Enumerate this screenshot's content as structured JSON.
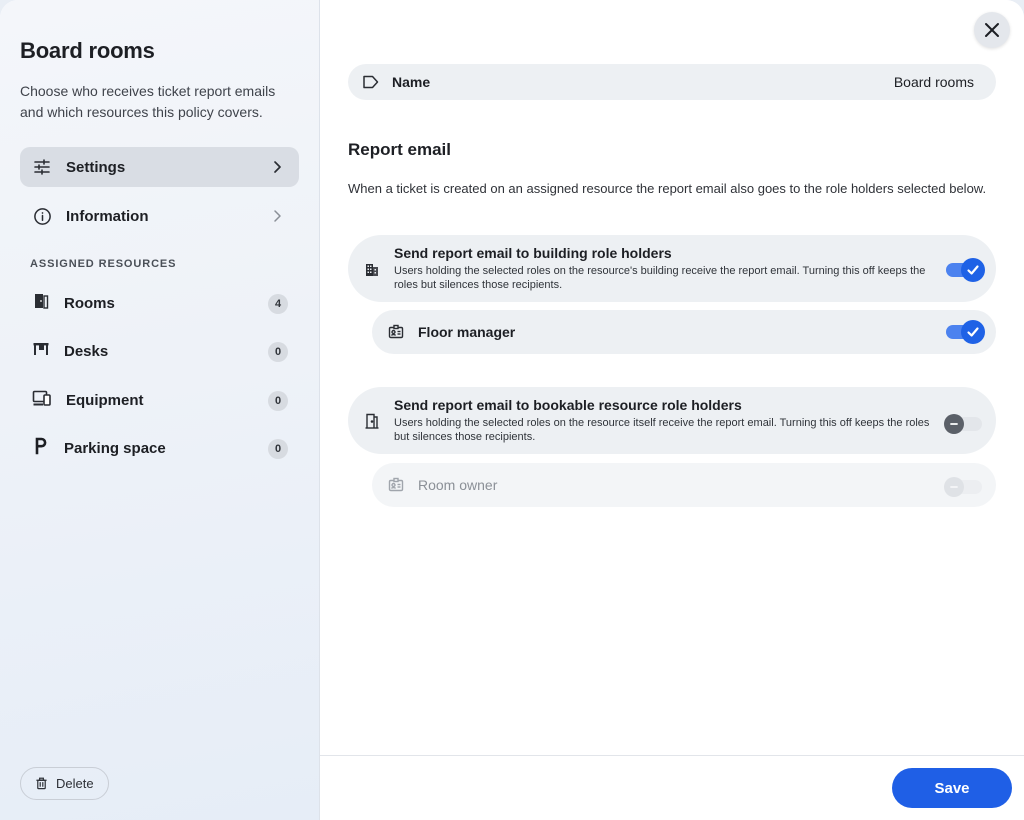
{
  "sidebar": {
    "title": "Board rooms",
    "description": "Choose who receives ticket report emails and which resources this policy covers.",
    "nav": [
      {
        "label": "Settings",
        "icon": "sliders-icon"
      },
      {
        "label": "Information",
        "icon": "info-icon"
      }
    ],
    "section_label": "ASSIGNED RESOURCES",
    "resources": [
      {
        "label": "Rooms",
        "count": "4",
        "icon": "door-icon"
      },
      {
        "label": "Desks",
        "count": "0",
        "icon": "desk-icon"
      },
      {
        "label": "Equipment",
        "count": "0",
        "icon": "devices-icon"
      },
      {
        "label": "Parking space",
        "count": "0",
        "icon": "parking-icon"
      }
    ],
    "delete_label": "Delete"
  },
  "main": {
    "name_field": {
      "label": "Name",
      "value": "Board rooms"
    },
    "section_title": "Report email",
    "section_desc": "When a ticket is created on an assigned resource the report email also goes to the role holders selected below.",
    "cards": [
      {
        "title": "Send report email to building role holders",
        "description": "Users holding the selected roles on the resource's building receive the report email. Turning this off keeps the roles but silences those recipients.",
        "enabled": true,
        "role": {
          "label": "Floor manager",
          "enabled": true
        }
      },
      {
        "title": "Send report email to bookable resource role holders",
        "description": "Users holding the selected roles on the resource itself receive the report email. Turning this off keeps the roles but silences those recipients.",
        "enabled": false,
        "role": {
          "label": "Room owner",
          "enabled": false
        }
      }
    ],
    "save_label": "Save"
  },
  "colors": {
    "accent": "#1f5fe6",
    "toggle_on_track": "#4c82ef",
    "active_nav": "#d9dde4"
  }
}
